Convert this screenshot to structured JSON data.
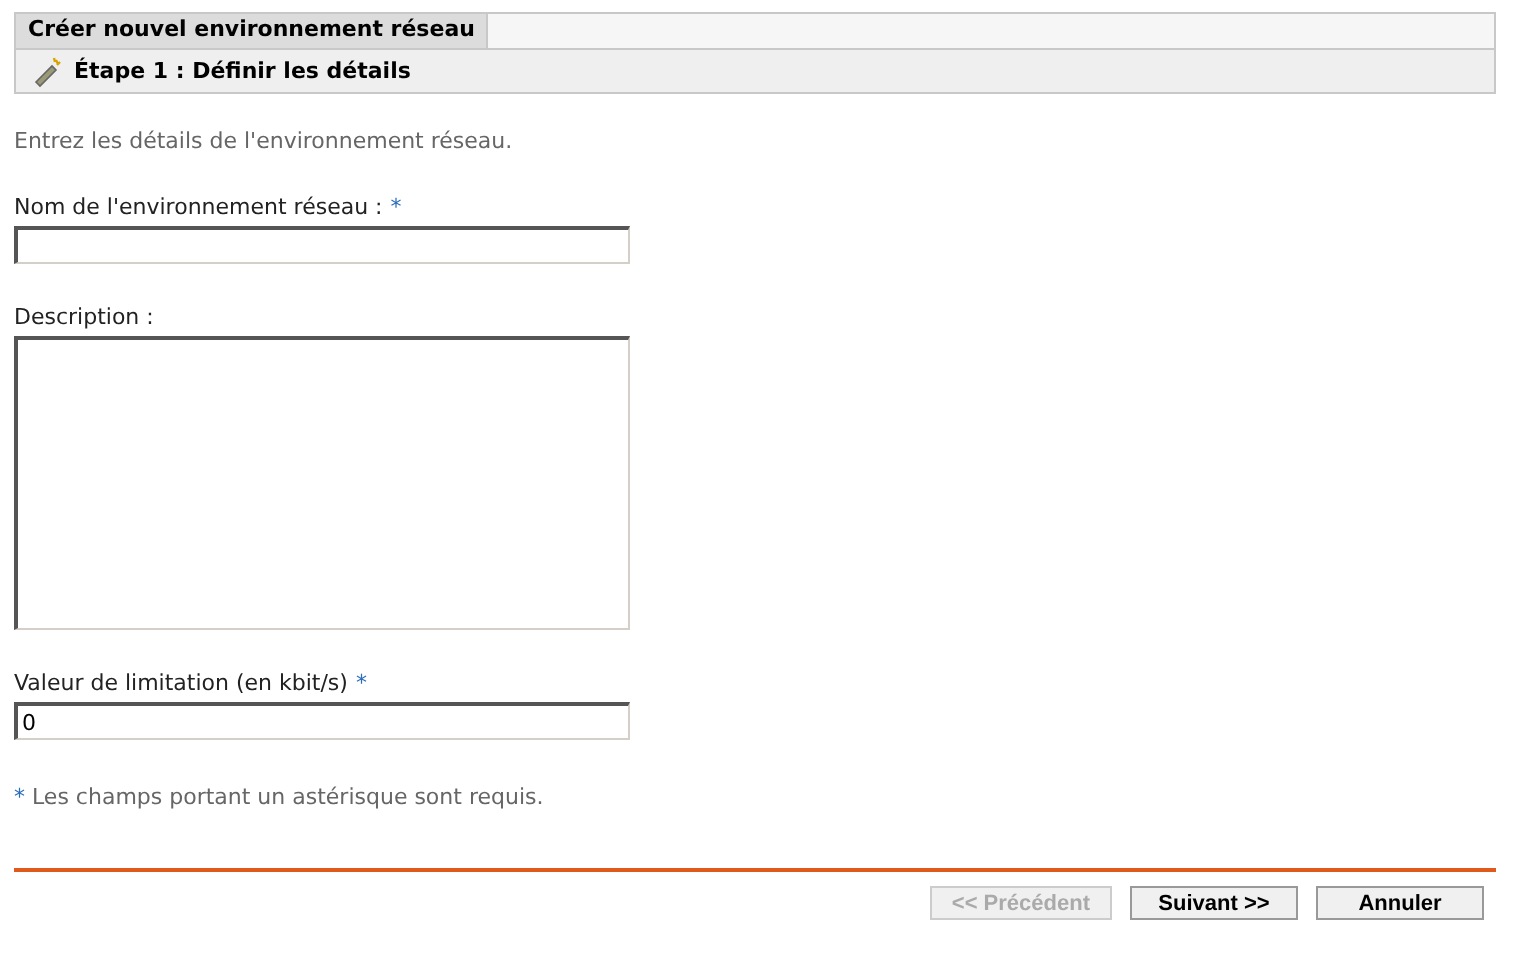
{
  "window": {
    "title": "Créer nouvel environnement réseau"
  },
  "step": {
    "title": "Étape 1 : Définir les détails"
  },
  "intro": "Entrez les détails de l'environnement réseau.",
  "fields": [
    {
      "kind": "input",
      "label": "Nom de l'environnement réseau :",
      "required": true
    },
    {
      "kind": "textarea",
      "label": "Description :",
      "required": false
    },
    {
      "kind": "input",
      "label": "Valeur de limitation (en kbit/s)",
      "required": true,
      "value": "0"
    }
  ],
  "required_note": {
    "mark": "*",
    "text": "Les champs portant un astérisque sont requis."
  },
  "buttons": [
    {
      "label": "<< Précédent",
      "disabled": true
    },
    {
      "label": "Suivant >>",
      "disabled": false
    },
    {
      "label": "Annuler",
      "disabled": false
    }
  ]
}
